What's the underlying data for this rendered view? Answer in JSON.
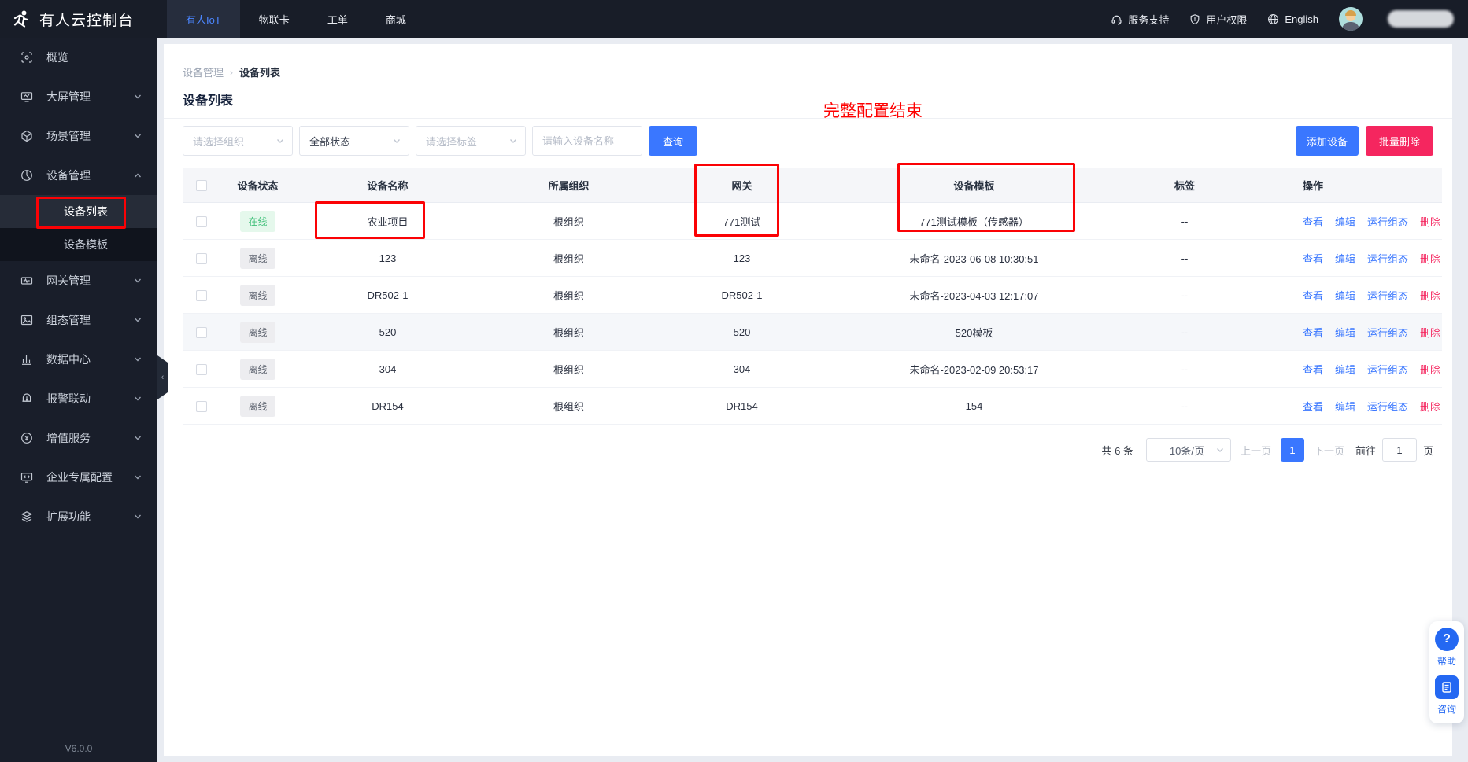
{
  "topbar": {
    "logo_title": "有人云控制台",
    "tabs": [
      {
        "label": "有人IoT",
        "active": true
      },
      {
        "label": "物联卡",
        "active": false
      },
      {
        "label": "工单",
        "active": false
      },
      {
        "label": "商城",
        "active": false
      }
    ],
    "support": "服务支持",
    "permission": "用户权限",
    "language": "English"
  },
  "sidebar": {
    "overview": "概览",
    "screen": "大屏管理",
    "scene": "场景管理",
    "device": "设备管理",
    "device_list": "设备列表",
    "device_template": "设备模板",
    "gateway": "网关管理",
    "hmi": "组态管理",
    "data_center": "数据中心",
    "alarm": "报警联动",
    "vas": "增值服务",
    "enterprise": "企业专属配置",
    "extension": "扩展功能",
    "version": "V6.0.0"
  },
  "breadcrumb": {
    "parent": "设备管理",
    "sep": "›",
    "current": "设备列表"
  },
  "page": {
    "title": "设备列表"
  },
  "annotation": {
    "text": "完整配置结束"
  },
  "filters": {
    "org_placeholder": "请选择组织",
    "status_value": "全部状态",
    "tag_placeholder": "请选择标签",
    "name_placeholder": "请输入设备名称",
    "query_button": "查询",
    "add_button": "添加设备",
    "batch_delete_button": "批量删除"
  },
  "table": {
    "headers": {
      "status": "设备状态",
      "name": "设备名称",
      "org": "所属组织",
      "gateway": "网关",
      "template": "设备模板",
      "tag": "标签",
      "op": "操作"
    },
    "actions": {
      "view": "查看",
      "edit": "编辑",
      "run": "运行组态",
      "delete": "删除"
    },
    "rows": [
      {
        "status": "在线",
        "name": "农业项目",
        "org": "根组织",
        "gateway": "771测试",
        "template": "771测试模板（传感器）",
        "tag": "--"
      },
      {
        "status": "离线",
        "name": "123",
        "org": "根组织",
        "gateway": "123",
        "template": "未命名-2023-06-08 10:30:51",
        "tag": "--"
      },
      {
        "status": "离线",
        "name": "DR502-1",
        "org": "根组织",
        "gateway": "DR502-1",
        "template": "未命名-2023-04-03 12:17:07",
        "tag": "--"
      },
      {
        "status": "离线",
        "name": "520",
        "org": "根组织",
        "gateway": "520",
        "template": "520模板",
        "tag": "--"
      },
      {
        "status": "离线",
        "name": "304",
        "org": "根组织",
        "gateway": "304",
        "template": "未命名-2023-02-09 20:53:17",
        "tag": "--"
      },
      {
        "status": "离线",
        "name": "DR154",
        "org": "根组织",
        "gateway": "DR154",
        "template": "154",
        "tag": "--"
      }
    ]
  },
  "pagination": {
    "total": "共 6 条",
    "page_size": "10条/页",
    "prev": "上一页",
    "current": "1",
    "next": "下一页",
    "goto": "前往",
    "goto_value": "1",
    "unit": "页"
  },
  "float_widget": {
    "help": "帮助",
    "consult": "咨询",
    "question_mark": "?"
  },
  "colors": {
    "accent": "#3a77ff",
    "danger": "#f5265f",
    "online_green": "#41c07a",
    "annotation_red": "#fb0205",
    "dark_bg": "#181d28"
  }
}
